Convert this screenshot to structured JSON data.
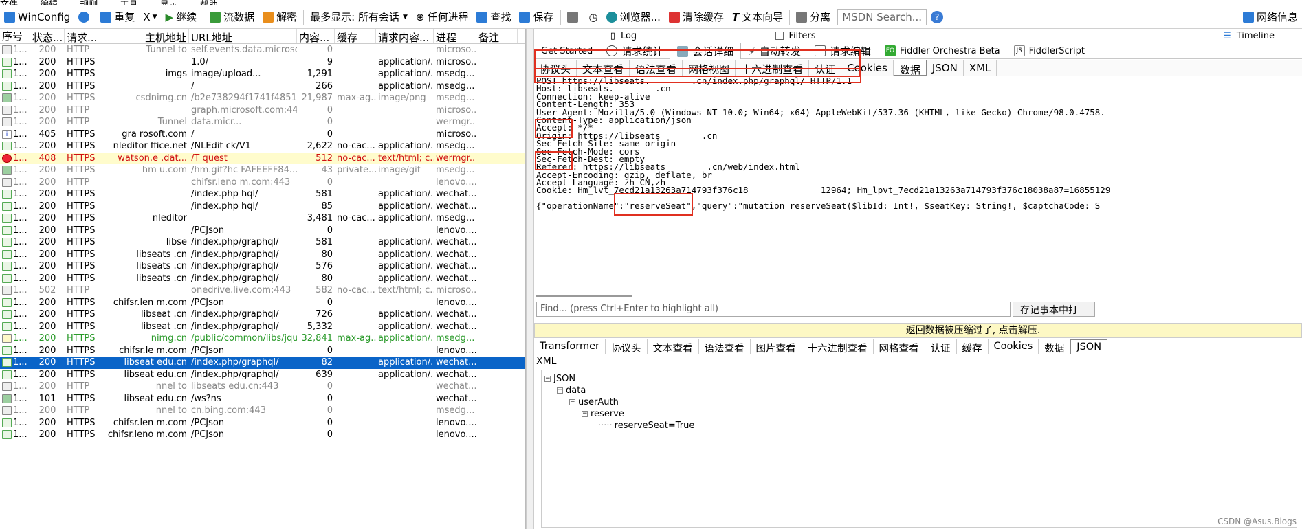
{
  "menubar": {
    "items": [
      "文件",
      "编辑",
      "规则",
      "工具",
      "显示",
      "帮助"
    ]
  },
  "toolbar": {
    "winconfig": "WinConfig",
    "replay": "重复",
    "remove": "X",
    "resume": "继续",
    "stream": "流数据",
    "decode": "解密",
    "keep": "最多显示: 所有会话",
    "any_process": "任何进程",
    "find": "查找",
    "save": "保存",
    "browse": "浏览器...",
    "clear_cache": "清除缓存",
    "text_wizard": "文本向导",
    "tearoff": "分离",
    "msdn_search": "MSDN Search...",
    "online": "网络信息"
  },
  "grid": {
    "columns": [
      "序号",
      "状态...",
      "请求...",
      "主机地址",
      "URL地址",
      "内容...",
      "缓存",
      "请求内容...",
      "进程",
      "备注"
    ],
    "rows": [
      {
        "id": "1...",
        "status": "200",
        "proto": "HTTP",
        "host": "Tunnel to",
        "url": "self.events.data.microsof...",
        "size": "0",
        "cache": "",
        "ctype": "",
        "proc": "microso...",
        "style": "gray",
        "icon": "lock"
      },
      {
        "id": "1...",
        "status": "200",
        "proto": "HTTPS",
        "host": "",
        "url": "1.0/",
        "size": "9",
        "cache": "",
        "ctype": "application/...",
        "proc": "microso...",
        "style": "",
        "icon": "arrow"
      },
      {
        "id": "1...",
        "status": "200",
        "proto": "HTTPS",
        "host": "imgs",
        "url": "image/upload...",
        "size": "1,291",
        "cache": "",
        "ctype": "application/...",
        "proc": "msedg...",
        "style": "",
        "icon": "arrow"
      },
      {
        "id": "1...",
        "status": "200",
        "proto": "HTTPS",
        "host": "",
        "url": "/",
        "size": "266",
        "cache": "",
        "ctype": "application/...",
        "proc": "msedg...",
        "style": "",
        "icon": "arrow"
      },
      {
        "id": "1...",
        "status": "200",
        "proto": "HTTPS",
        "host": "csdnimg.cn",
        "url": "/b2e738294f1741f4851dd...",
        "size": "21,987",
        "cache": "max-ag...",
        "ctype": "image/png",
        "proc": "msedg...",
        "style": "gray",
        "icon": "img"
      },
      {
        "id": "1...",
        "status": "200",
        "proto": "HTTP",
        "host": "",
        "url": "graph.microsoft.com:443",
        "size": "0",
        "cache": "",
        "ctype": "",
        "proc": "microso...",
        "style": "gray",
        "icon": "lock"
      },
      {
        "id": "1...",
        "status": "200",
        "proto": "HTTP",
        "host": "Tunnel",
        "url": "data.micr...",
        "size": "0",
        "cache": "",
        "ctype": "",
        "proc": "wermgr...",
        "style": "gray",
        "icon": "lock"
      },
      {
        "id": "1...",
        "status": "405",
        "proto": "HTTPS",
        "host": "gra  rosoft.com",
        "url": "/",
        "size": "0",
        "cache": "",
        "ctype": "",
        "proc": "microso...",
        "style": "",
        "icon": "info"
      },
      {
        "id": "1...",
        "status": "200",
        "proto": "HTTPS",
        "host": "nleditor  ffice.net",
        "url": "/NLEdit  ck/V1",
        "size": "2,622",
        "cache": "no-cac...",
        "ctype": "application/...",
        "proc": "msedg...",
        "style": "",
        "icon": "arrow"
      },
      {
        "id": "1...",
        "status": "408",
        "proto": "HTTPS",
        "host": "watson.e  .dat...",
        "url": "/T  quest",
        "size": "512",
        "cache": "no-cac...",
        "ctype": "text/html; c...",
        "proc": "wermgr...",
        "style": "red",
        "icon": "err"
      },
      {
        "id": "1...",
        "status": "200",
        "proto": "HTTPS",
        "host": "hm  u.com",
        "url": "/hm.gif?hc  FAFEEFF84...",
        "size": "43",
        "cache": "private...",
        "ctype": "image/gif",
        "proc": "msedg...",
        "style": "gray",
        "icon": "img"
      },
      {
        "id": "1...",
        "status": "200",
        "proto": "HTTP",
        "host": "",
        "url": "chifsr.leno  m.com:443",
        "size": "0",
        "cache": "",
        "ctype": "",
        "proc": "lenovo....",
        "style": "gray",
        "icon": "lock"
      },
      {
        "id": "1...",
        "status": "200",
        "proto": "HTTPS",
        "host": "",
        "url": "/index.php  hql/",
        "size": "581",
        "cache": "",
        "ctype": "application/...",
        "proc": "wechat...",
        "style": "",
        "icon": "arrow"
      },
      {
        "id": "1...",
        "status": "200",
        "proto": "HTTPS",
        "host": "",
        "url": "/index.php  hql/",
        "size": "85",
        "cache": "",
        "ctype": "application/...",
        "proc": "wechat...",
        "style": "",
        "icon": "arrow"
      },
      {
        "id": "1...",
        "status": "200",
        "proto": "HTTPS",
        "host": "nleditor",
        "url": "",
        "size": "3,481",
        "cache": "no-cac...",
        "ctype": "application/...",
        "proc": "msedg...",
        "style": "",
        "icon": "arrow"
      },
      {
        "id": "1...",
        "status": "200",
        "proto": "HTTPS",
        "host": "",
        "url": "/PCJson",
        "size": "0",
        "cache": "",
        "ctype": "",
        "proc": "lenovo....",
        "style": "",
        "icon": "arrow"
      },
      {
        "id": "1...",
        "status": "200",
        "proto": "HTTPS",
        "host": "libse",
        "url": "/index.php/graphql/",
        "size": "581",
        "cache": "",
        "ctype": "application/...",
        "proc": "wechat...",
        "style": "",
        "icon": "arrow"
      },
      {
        "id": "1...",
        "status": "200",
        "proto": "HTTPS",
        "host": "libseats  .cn",
        "url": "/index.php/graphql/",
        "size": "80",
        "cache": "",
        "ctype": "application/...",
        "proc": "wechat...",
        "style": "",
        "icon": "arrow"
      },
      {
        "id": "1...",
        "status": "200",
        "proto": "HTTPS",
        "host": "libseats  .cn",
        "url": "/index.php/graphql/",
        "size": "576",
        "cache": "",
        "ctype": "application/...",
        "proc": "wechat...",
        "style": "",
        "icon": "arrow"
      },
      {
        "id": "1...",
        "status": "200",
        "proto": "HTTPS",
        "host": "libseats  .cn",
        "url": "/index.php/graphql/",
        "size": "80",
        "cache": "",
        "ctype": "application/...",
        "proc": "wechat...",
        "style": "",
        "icon": "arrow"
      },
      {
        "id": "1...",
        "status": "502",
        "proto": "HTTP",
        "host": "",
        "url": "onedrive.live.com:443",
        "size": "582",
        "cache": "no-cac...",
        "ctype": "text/html; c...",
        "proc": "microso...",
        "style": "gray",
        "icon": "lock"
      },
      {
        "id": "1...",
        "status": "200",
        "proto": "HTTPS",
        "host": "chifsr.len  m.com",
        "url": "/PCJson",
        "size": "0",
        "cache": "",
        "ctype": "",
        "proc": "lenovo....",
        "style": "",
        "icon": "arrow"
      },
      {
        "id": "1...",
        "status": "200",
        "proto": "HTTPS",
        "host": "libseat  .cn",
        "url": "/index.php/graphql/",
        "size": "726",
        "cache": "",
        "ctype": "application/...",
        "proc": "wechat...",
        "style": "",
        "icon": "arrow"
      },
      {
        "id": "1...",
        "status": "200",
        "proto": "HTTPS",
        "host": "libseat  .cn",
        "url": "/index.php/graphql/",
        "size": "5,332",
        "cache": "",
        "ctype": "application/...",
        "proc": "wechat...",
        "style": "",
        "icon": "arrow"
      },
      {
        "id": "1...",
        "status": "200",
        "proto": "HTTPS",
        "host": "nimg.cn",
        "url": "/public/common/libs/jquer...",
        "size": "32,841",
        "cache": "max-ag...",
        "ctype": "application/...",
        "proc": "msedg...",
        "style": "green",
        "icon": "js"
      },
      {
        "id": "1...",
        "status": "200",
        "proto": "HTTPS",
        "host": "chifsr.le  m.com",
        "url": "/PCJson",
        "size": "0",
        "cache": "",
        "ctype": "",
        "proc": "lenovo....",
        "style": "",
        "icon": "arrow"
      },
      {
        "id": "1...",
        "status": "200",
        "proto": "HTTPS",
        "host": "libseat  edu.cn",
        "url": "/index.php/graphql/",
        "size": "82",
        "cache": "",
        "ctype": "application/...",
        "proc": "wechat...",
        "style": "sel",
        "icon": "arrow"
      },
      {
        "id": "1...",
        "status": "200",
        "proto": "HTTPS",
        "host": "libseat  edu.cn",
        "url": "/index.php/graphql/",
        "size": "639",
        "cache": "",
        "ctype": "application/...",
        "proc": "wechat...",
        "style": "",
        "icon": "arrow"
      },
      {
        "id": "1...",
        "status": "200",
        "proto": "HTTP",
        "host": "nnel to",
        "url": "libseats  edu.cn:443",
        "size": "0",
        "cache": "",
        "ctype": "",
        "proc": "wechat...",
        "style": "gray",
        "icon": "lock"
      },
      {
        "id": "1...",
        "status": "101",
        "proto": "HTTPS",
        "host": "libseat  edu.cn",
        "url": "/ws?ns",
        "size": "0",
        "cache": "",
        "ctype": "",
        "proc": "wechat...",
        "style": "",
        "icon": "img"
      },
      {
        "id": "1...",
        "status": "200",
        "proto": "HTTP",
        "host": "nnel to",
        "url": "cn.bing.com:443",
        "size": "0",
        "cache": "",
        "ctype": "",
        "proc": "msedg...",
        "style": "gray",
        "icon": "lock"
      },
      {
        "id": "1...",
        "status": "200",
        "proto": "HTTPS",
        "host": "chifsr.len  m.com",
        "url": "/PCJson",
        "size": "0",
        "cache": "",
        "ctype": "",
        "proc": "lenovo....",
        "style": "",
        "icon": "arrow"
      },
      {
        "id": "1...",
        "status": "200",
        "proto": "HTTPS",
        "host": "chifsr.leno  m.com",
        "url": "/PCJson",
        "size": "0",
        "cache": "",
        "ctype": "",
        "proc": "lenovo....",
        "style": "",
        "icon": "arrow"
      }
    ]
  },
  "right": {
    "tabs_top": [
      "Log",
      "Filters",
      "Timeline"
    ],
    "tabs_main": [
      "Get Started",
      "请求统计",
      "会话详细",
      "自动转发",
      "请求编辑",
      "Fiddler Orchestra Beta",
      "FiddlerScript"
    ],
    "inspector_tabs": [
      "协议头",
      "文本查看",
      "语法查看",
      "网格视图",
      "十六进制查看",
      "认证",
      "Cookies",
      "数据",
      "JSON",
      "XML"
    ],
    "raw_lines": [
      "POST https://libseats.        .cn/index.php/graphql/ HTTP/1.1",
      "Host: libseats.        .cn",
      "Connection: keep-alive",
      "Content-Length: 353",
      "User-Agent: Mozilla/5.0 (Windows NT 10.0; Win64; x64) AppleWebKit/537.36 (KHTML, like Gecko) Chrome/98.0.4758.",
      "Content-Type: application/json",
      "Accept: */*",
      "Origin: https://libseats        .cn",
      "Sec-Fetch-Site: same-origin",
      "Sec-Fetch-Mode: cors",
      "Sec-Fetch-Dest: empty",
      "Referer: https://libseats        .cn/web/index.html",
      "Accept-Encoding: gzip, deflate, br",
      "Accept-Language: zh-CN,zh",
      "Cookie: Hm_lvt_7ecd21a13263a714793f376c18              12964; Hm_lpvt_7ecd21a13263a714793f376c18038a87=16855129",
      "",
      "{\"operationName\":\"reserveSeat\",\"query\":\"mutation reserveSeat($libId: Int!, $seatKey: String!, $captchaCode: S"
    ],
    "find_placeholder": "Find... (press Ctrl+Enter to highlight all)",
    "find_button": "存记事本中打",
    "banner": "返回数据被压缩过了, 点击解压.",
    "response_tabs": [
      "Transformer",
      "协议头",
      "文本查看",
      "语法查看",
      "图片查看",
      "十六进制查看",
      "网格查看",
      "认证",
      "缓存",
      "Cookies",
      "数据",
      "JSON"
    ],
    "response_xml": "XML",
    "tree": [
      "JSON",
      "data",
      "userAuth",
      "reserve",
      "reserveSeat=True"
    ]
  },
  "watermark": "CSDN @Asus.Blogs"
}
